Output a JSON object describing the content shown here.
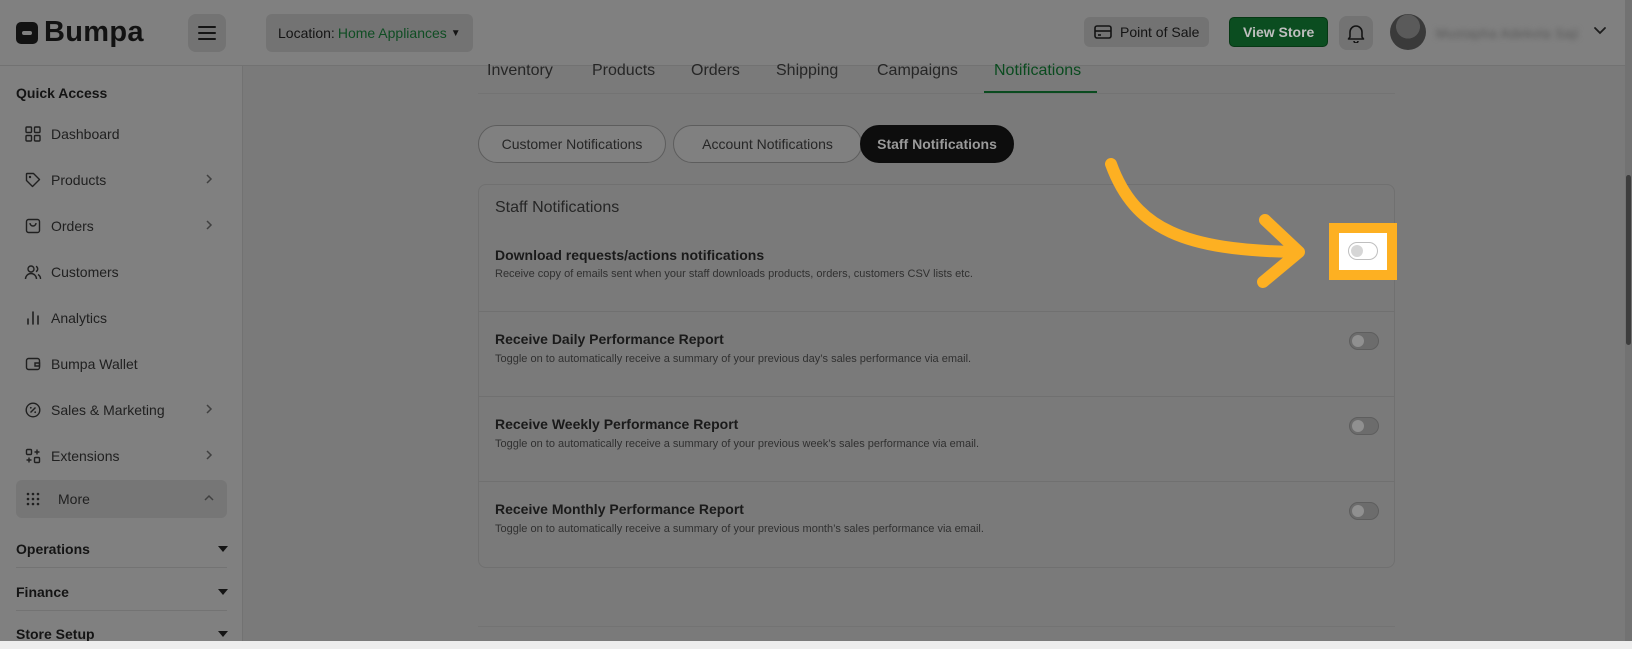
{
  "header": {
    "logo_text": "Bumpa",
    "location_label": "Location:",
    "location_value": "Home Appliances",
    "pos_label": "Point of Sale",
    "view_store_label": "View Store",
    "username": "Mustapha Adekola Saji"
  },
  "sidebar": {
    "quick_access_title": "Quick Access",
    "items": [
      {
        "label": "Dashboard",
        "icon": "grid-icon"
      },
      {
        "label": "Products",
        "icon": "tag-icon",
        "has_chevron": true
      },
      {
        "label": "Orders",
        "icon": "bag-icon",
        "has_chevron": true
      },
      {
        "label": "Customers",
        "icon": "users-icon"
      },
      {
        "label": "Analytics",
        "icon": "bar-chart-icon"
      },
      {
        "label": "Bumpa Wallet",
        "icon": "wallet-icon"
      },
      {
        "label": "Sales & Marketing",
        "icon": "percent-icon",
        "has_chevron": true
      },
      {
        "label": "Extensions",
        "icon": "extensions-icon",
        "has_chevron": true
      }
    ],
    "more_label": "More",
    "sections": [
      "Operations",
      "Finance",
      "Store Setup"
    ]
  },
  "tabs": {
    "items": [
      "Inventory",
      "Products",
      "Orders",
      "Shipping",
      "Campaigns",
      "Notifications"
    ],
    "active": "Notifications"
  },
  "subtabs": {
    "items": [
      "Customer Notifications",
      "Account Notifications",
      "Staff Notifications"
    ],
    "active": "Staff Notifications"
  },
  "card": {
    "title": "Staff Notifications",
    "rows": [
      {
        "title": "Download requests/actions notifications",
        "description": "Receive copy of emails sent when your staff downloads products, orders, customers CSV lists etc.",
        "enabled": false
      },
      {
        "title": "Receive Daily Performance Report",
        "description": "Toggle on to automatically receive a summary of your previous day’s sales performance via email.",
        "enabled": false
      },
      {
        "title": "Receive Weekly Performance Report",
        "description": "Toggle on to automatically receive a summary of your previous week’s sales performance via email.",
        "enabled": false
      },
      {
        "title": "Receive Monthly Performance Report",
        "description": "Toggle on to automatically receive a summary of your previous month’s sales performance via email.",
        "enabled": false
      }
    ]
  },
  "colors": {
    "accent_green": "#0a4b1f",
    "highlight_orange": "#fdb022",
    "overlay_gray": "#808080"
  }
}
